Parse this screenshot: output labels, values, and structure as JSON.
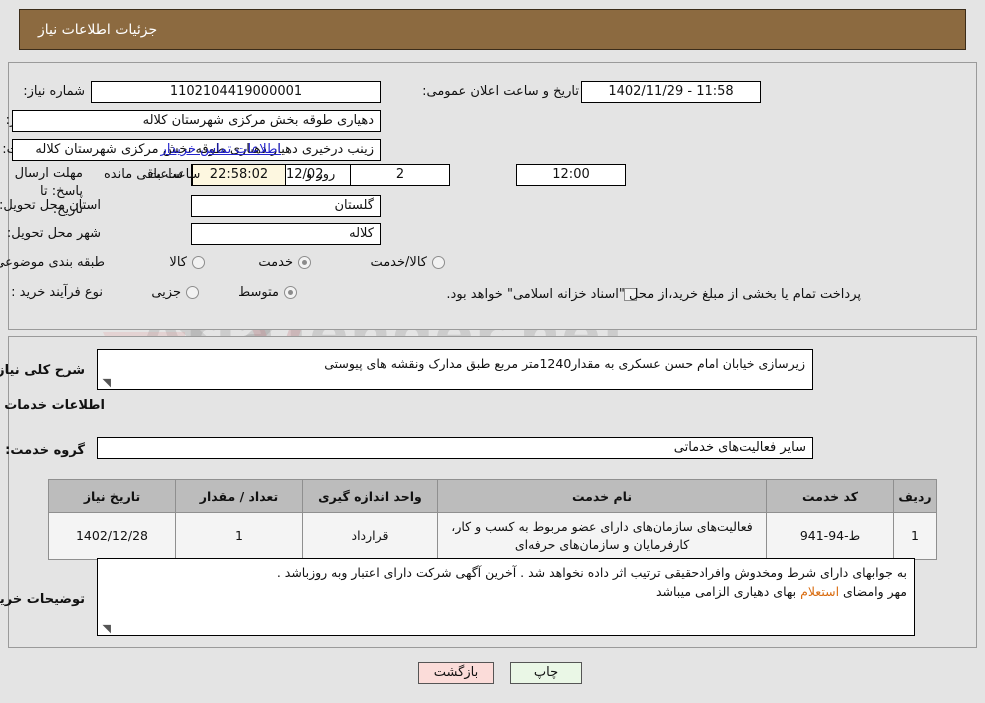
{
  "header": {
    "title": "جزئیات اطلاعات نیاز"
  },
  "watermark": {
    "text": "AriaTender.net",
    "v_letter": "V"
  },
  "form": {
    "need_number_label": "شماره نیاز:",
    "need_number_value": "1102104419000001",
    "announce_label": "تاریخ و ساعت اعلان عمومی:",
    "announce_value": "11:58 - 1402/11/29",
    "buyer_org_label": "نام دستگاه خریدار:",
    "buyer_org_value": "دهیاری طوقه بخش مرکزی شهرستان کلاله",
    "creator_label": "ایجاد کننده درخواست:",
    "creator_value": "زینب درخیری دهیار دهیاری طوقه بخش مرکزی شهرستان کلاله",
    "contact_link": "اطلاعات تماس خریدار",
    "deadline_label": "مهلت ارسال پاسخ: تا تاریخ:",
    "deadline_date": "1402/12/02",
    "hour_label": "ساعت",
    "hour_value": "12:00",
    "days_value": "2",
    "days_and_label": "روز و",
    "countdown_value": "22:58:02",
    "remaining_label": "ساعت باقی مانده",
    "province_label": "استان محل تحویل:",
    "province_value": "گلستان",
    "city_label": "شهر محل تحویل:",
    "city_value": "کلاله",
    "category_label": "طبقه بندی موضوعی:",
    "category_options": [
      {
        "label": "کالا",
        "selected": false
      },
      {
        "label": "خدمت",
        "selected": true
      },
      {
        "label": "کالا/خدمت",
        "selected": false
      }
    ],
    "purchase_type_label": "نوع فرآیند خرید :",
    "purchase_type_options": [
      {
        "label": "جزیی",
        "selected": false
      },
      {
        "label": "متوسط",
        "selected": true
      }
    ],
    "treasury_checkbox_label": "پرداخت تمام یا بخشی از مبلغ خرید،از محل \"اسناد خزانه اسلامی\" خواهد بود.",
    "summary_label": "شرح کلی نیاز:",
    "summary_value": "زیرسازی خیابان امام حسن عسکری به مقدار1240متر مربع طبق مدارک ونقشه های پیوستی",
    "services_section_title": "اطلاعات خدمات مورد نیاز",
    "service_group_label": "گروه خدمت:",
    "service_group_value": "سایر فعالیت‌های خدماتی",
    "buyer_notes_label": "توضیحات خریدار:",
    "buyer_notes_line1": "به جوابهای دارای شرط ومخدوش وافرادحقیقی ترتیب اثر داده نخواهد شد . آخرین آگهی شرکت دارای اعتبار وبه روزباشد .",
    "buyer_notes_line2_pre": "مهر وامضای ",
    "buyer_notes_line2_hl": "استعلام",
    "buyer_notes_line2_post": " بهای دهیاری الزامی میباشد"
  },
  "table": {
    "columns": [
      "ردیف",
      "کد خدمت",
      "نام خدمت",
      "واحد اندازه گیری",
      "تعداد / مقدار",
      "تاریخ نیاز"
    ],
    "rows": [
      {
        "row_no": "1",
        "service_code": "ط-94-941",
        "service_name": "فعالیت‌های سازمان‌های دارای عضو مربوط به کسب و کار، کارفرمایان و سازمان‌های حرفه‌ای",
        "unit": "قرارداد",
        "quantity": "1",
        "need_date": "1402/12/28"
      }
    ]
  },
  "footer": {
    "print_label": "چاپ",
    "back_label": "بازگشت"
  }
}
